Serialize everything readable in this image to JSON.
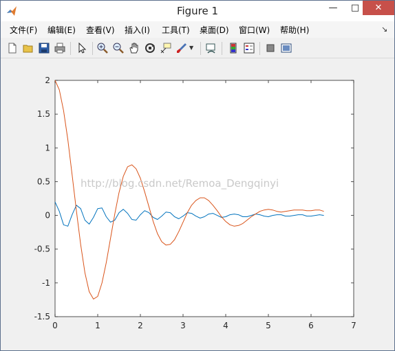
{
  "window": {
    "title": "Figure 1"
  },
  "menu": {
    "items": [
      "文件(F)",
      "编辑(E)",
      "查看(V)",
      "插入(I)",
      "工具(T)",
      "桌面(D)",
      "窗口(W)",
      "帮助(H)"
    ]
  },
  "toolbar": {
    "icons": [
      "new-figure-icon",
      "open-file-icon",
      "save-icon",
      "print-icon",
      "pointer-icon",
      "zoom-in-icon",
      "zoom-out-icon",
      "pan-icon",
      "rotate-3d-icon",
      "data-cursor-icon",
      "brush-icon",
      "link-plot-icon",
      "colorbar-icon",
      "legend-icon",
      "hide-plot-tools-icon",
      "show-plot-tools-icon"
    ]
  },
  "watermark": "http://blog.csdn.net/Remoa_Dengqinyi",
  "chart_data": {
    "type": "line",
    "title": "",
    "xlabel": "",
    "ylabel": "",
    "xlim": [
      0,
      7
    ],
    "ylim": [
      -1.5,
      2
    ],
    "xticks": [
      "0",
      "1",
      "2",
      "3",
      "4",
      "5",
      "6",
      "7"
    ],
    "yticks": [
      "-1.5",
      "-1",
      "-0.5",
      "0",
      "0.5",
      "1",
      "1.5",
      "2"
    ],
    "grid": false,
    "series": [
      {
        "color": "#0072bd",
        "x": [
          0,
          0.1,
          0.2,
          0.3,
          0.4,
          0.5,
          0.6,
          0.7,
          0.8,
          0.9,
          1.0,
          1.1,
          1.2,
          1.3,
          1.4,
          1.5,
          1.6,
          1.7,
          1.8,
          1.9,
          2.0,
          2.1,
          2.2,
          2.3,
          2.4,
          2.5,
          2.6,
          2.7,
          2.8,
          2.9,
          3.0,
          3.1,
          3.2,
          3.3,
          3.4,
          3.5,
          3.6,
          3.7,
          3.8,
          3.9,
          4.0,
          4.1,
          4.2,
          4.3,
          4.4,
          4.5,
          4.6,
          4.7,
          4.8,
          4.9,
          5.0,
          5.1,
          5.2,
          5.3,
          5.4,
          5.5,
          5.6,
          5.7,
          5.8,
          5.9,
          6.0,
          6.1,
          6.2,
          6.3
        ],
        "y": [
          0.2,
          0.06,
          -0.14,
          -0.16,
          0.01,
          0.15,
          0.1,
          -0.07,
          -0.13,
          -0.03,
          0.1,
          0.11,
          -0.02,
          -0.1,
          -0.07,
          0.04,
          0.09,
          0.03,
          -0.06,
          -0.07,
          0.01,
          0.07,
          0.04,
          -0.03,
          -0.06,
          -0.01,
          0.05,
          0.04,
          -0.02,
          -0.05,
          -0.01,
          0.04,
          0.03,
          -0.01,
          -0.04,
          -0.02,
          0.02,
          0.03,
          0.0,
          -0.03,
          -0.02,
          0.01,
          0.02,
          0.01,
          -0.02,
          -0.02,
          0.0,
          0.02,
          0.01,
          -0.01,
          -0.02,
          0.0,
          0.01,
          0.01,
          -0.01,
          -0.01,
          0.0,
          0.01,
          0.01,
          -0.01,
          -0.01,
          0.0,
          0.01,
          0.0
        ]
      },
      {
        "color": "#d95319",
        "x": [
          0,
          0.1,
          0.2,
          0.3,
          0.4,
          0.5,
          0.6,
          0.7,
          0.8,
          0.9,
          1.0,
          1.1,
          1.2,
          1.3,
          1.4,
          1.5,
          1.6,
          1.7,
          1.8,
          1.9,
          2.0,
          2.1,
          2.2,
          2.3,
          2.4,
          2.5,
          2.6,
          2.7,
          2.8,
          2.9,
          3.0,
          3.1,
          3.2,
          3.3,
          3.4,
          3.5,
          3.6,
          3.7,
          3.8,
          3.9,
          4.0,
          4.1,
          4.2,
          4.3,
          4.4,
          4.5,
          4.6,
          4.7,
          4.8,
          4.9,
          5.0,
          5.1,
          5.2,
          5.3,
          5.4,
          5.5,
          5.6,
          5.7,
          5.8,
          5.9,
          6.0,
          6.1,
          6.2,
          6.3
        ],
        "y": [
          2.0,
          1.86,
          1.55,
          1.12,
          0.6,
          0.07,
          -0.43,
          -0.85,
          -1.13,
          -1.24,
          -1.2,
          -1.0,
          -0.7,
          -0.34,
          0.02,
          0.34,
          0.58,
          0.72,
          0.75,
          0.69,
          0.55,
          0.35,
          0.13,
          -0.09,
          -0.27,
          -0.39,
          -0.44,
          -0.43,
          -0.36,
          -0.24,
          -0.1,
          0.04,
          0.15,
          0.22,
          0.26,
          0.26,
          0.22,
          0.15,
          0.07,
          -0.02,
          -0.09,
          -0.14,
          -0.16,
          -0.15,
          -0.12,
          -0.07,
          -0.02,
          0.02,
          0.06,
          0.08,
          0.09,
          0.08,
          0.06,
          0.05,
          0.06,
          0.07,
          0.08,
          0.08,
          0.08,
          0.07,
          0.07,
          0.08,
          0.08,
          0.06
        ]
      }
    ]
  }
}
